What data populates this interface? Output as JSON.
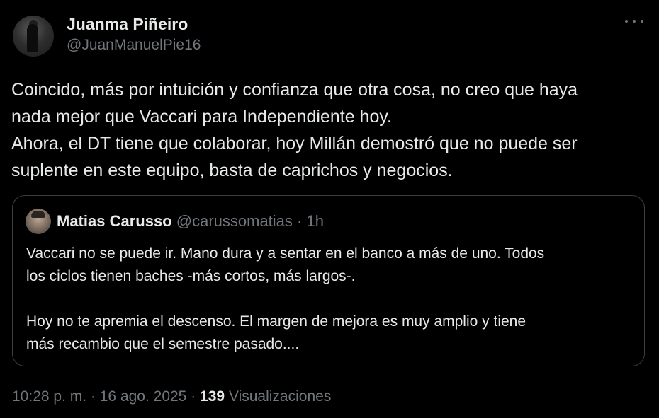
{
  "tweet": {
    "author": {
      "display_name": "Juanma Piñeiro",
      "handle": "@JuanManuelPie16"
    },
    "more_label": "···",
    "text_lines": [
      "Coincido, más por intuición y confianza que otra cosa, no creo que haya",
      "nada mejor que Vaccari para Independiente hoy.",
      "Ahora, el DT tiene que colaborar, hoy Millán demostró que no puede ser",
      "suplente en este equipo, basta de caprichos y negocios."
    ],
    "quote": {
      "display_name": "Matias Carusso",
      "handle": "@carussomatias",
      "separator": "·",
      "time": "1h",
      "paragraph1": [
        "Vaccari no se puede ir. Mano dura y a sentar en el banco a más de uno. Todos",
        "los ciclos tienen baches -más cortos, más largos-."
      ],
      "paragraph2": [
        "Hoy no te apremia el descenso. El margen de mejora es muy amplio y tiene",
        "más recambio que el semestre pasado...."
      ]
    },
    "footer": {
      "time": "10:28 p. m.",
      "sep1": "·",
      "date": "16 ago. 2025",
      "sep2": "·",
      "views_count": "139",
      "views_label": "Visualizaciones"
    }
  }
}
